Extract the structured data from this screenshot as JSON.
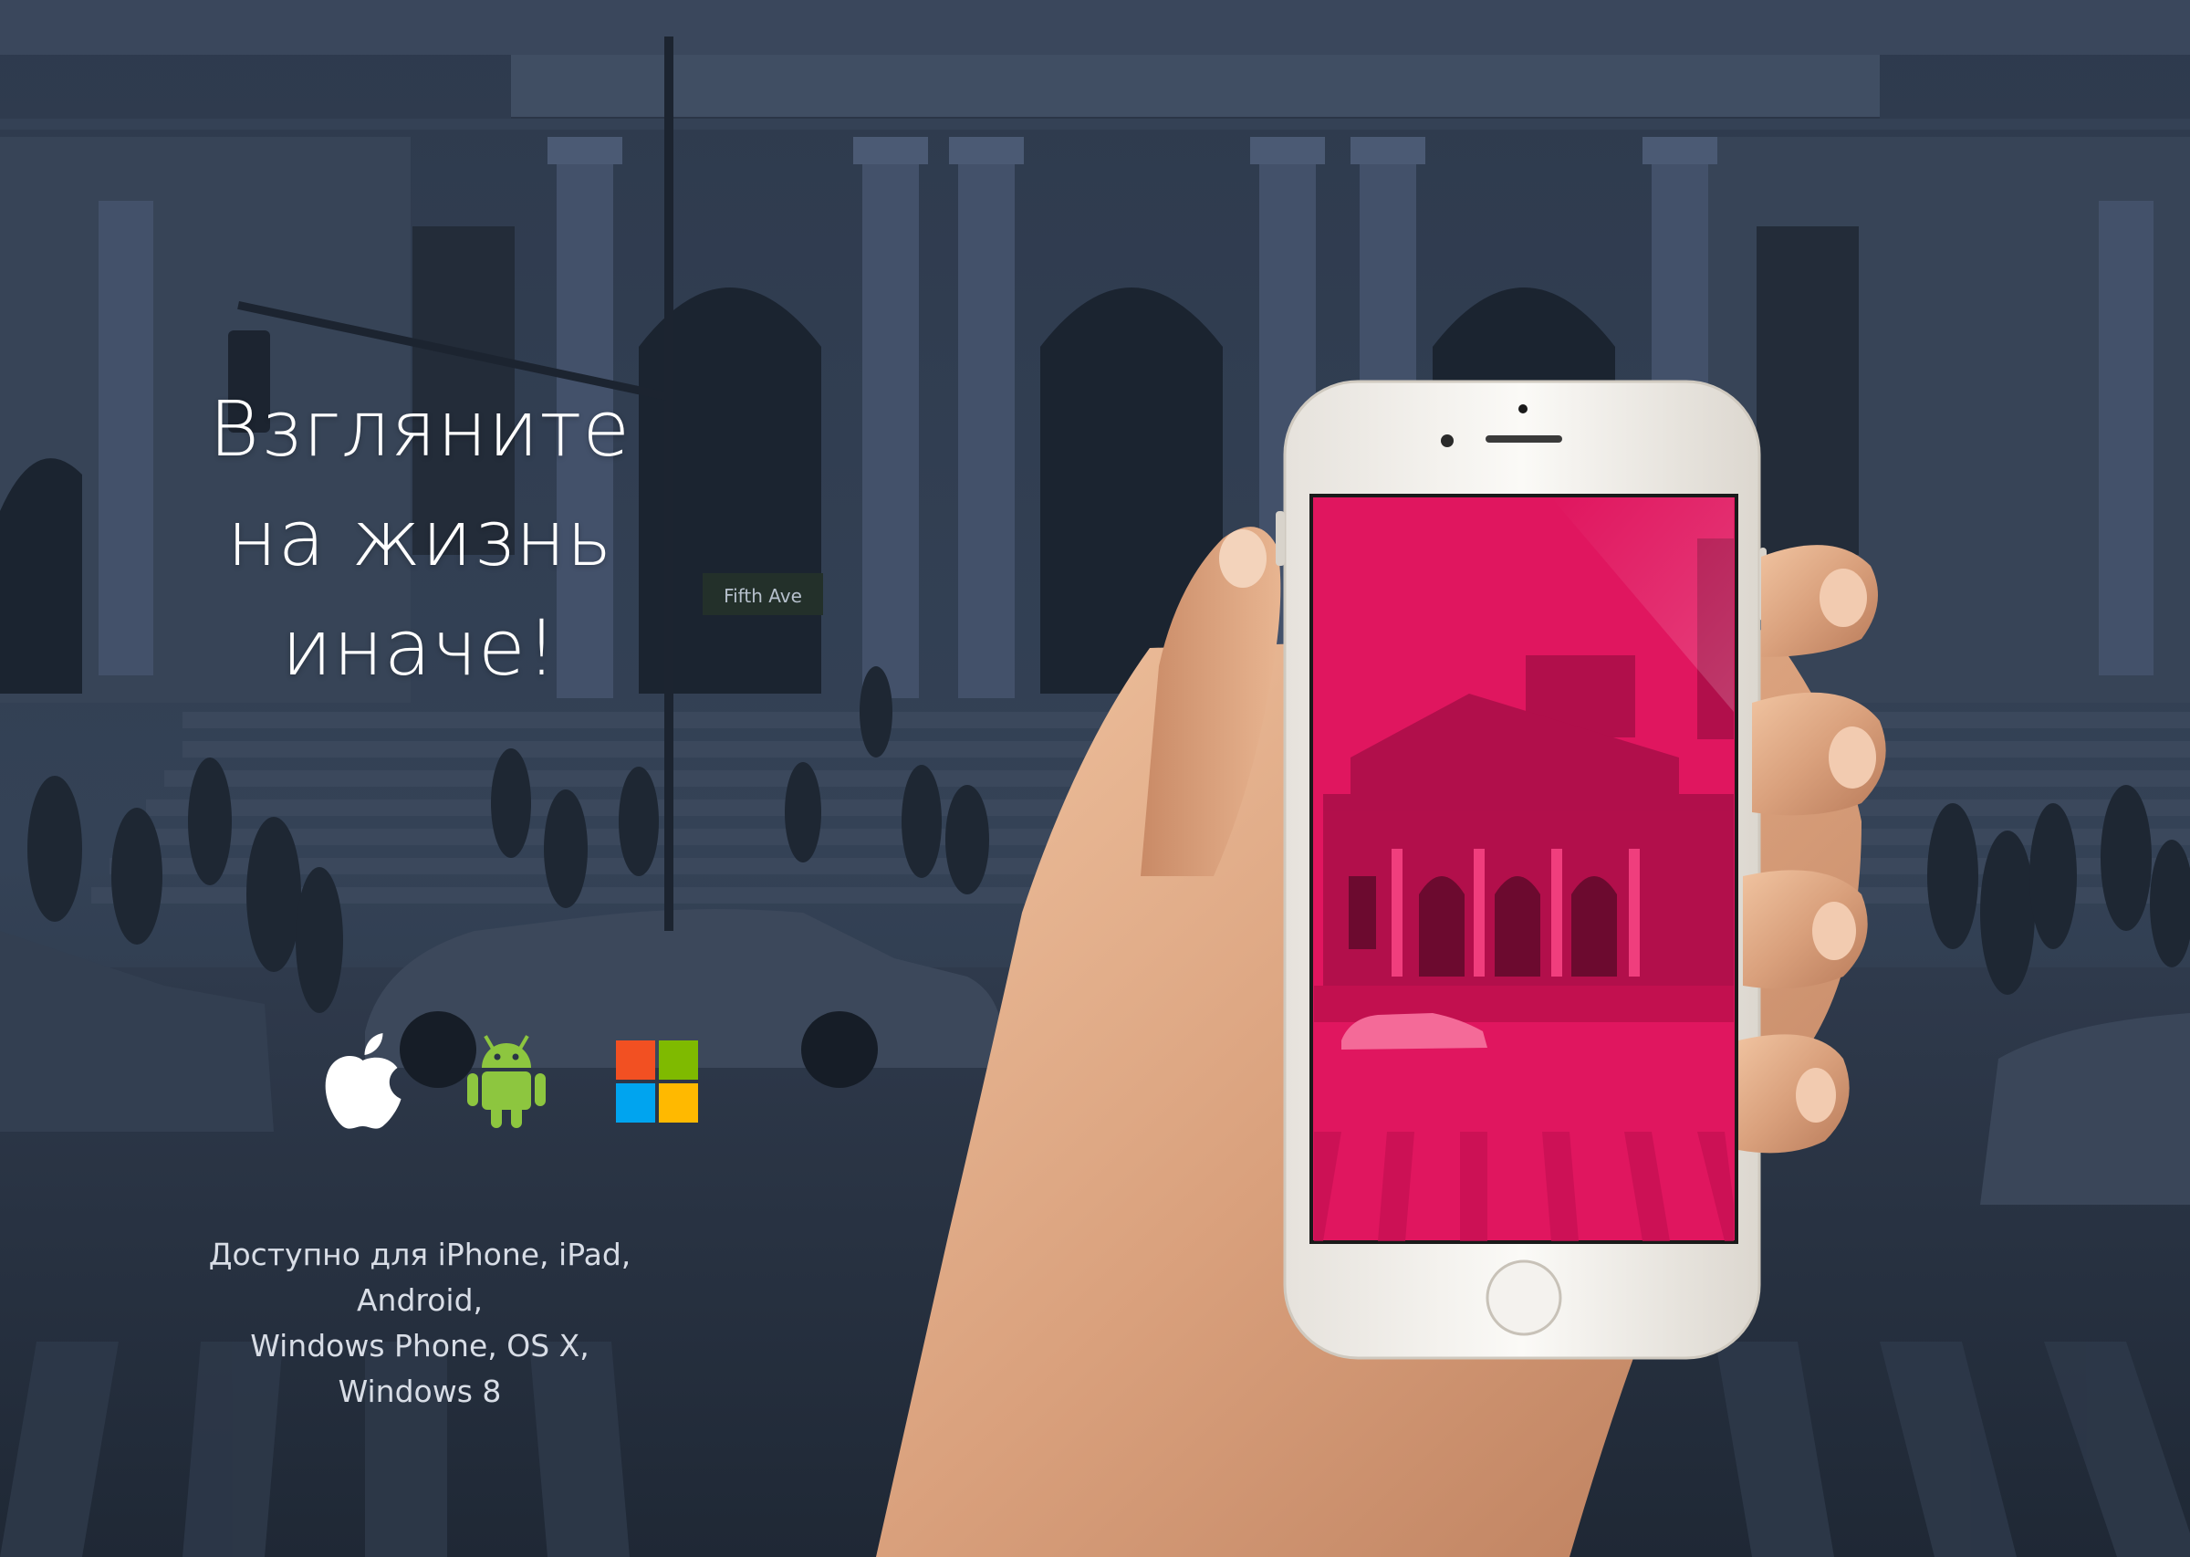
{
  "headline": {
    "line1": "Взгляните",
    "line2": "на жизнь",
    "line3": "иначе!"
  },
  "platforms": {
    "icons": [
      "apple-icon",
      "android-icon",
      "windows-icon"
    ],
    "android_color": "#8dc63f",
    "windows_colors": [
      "#f25022",
      "#7fba00",
      "#00a4ef",
      "#ffb900"
    ]
  },
  "availability": {
    "line1": "Доступно для iPhone, iPad, Android,",
    "line2": "Windows Phone, OS X, Windows 8"
  },
  "colors": {
    "background": "#2a3546",
    "phone_screen": "#e0165f",
    "phone_body": "#f4f2ee"
  }
}
